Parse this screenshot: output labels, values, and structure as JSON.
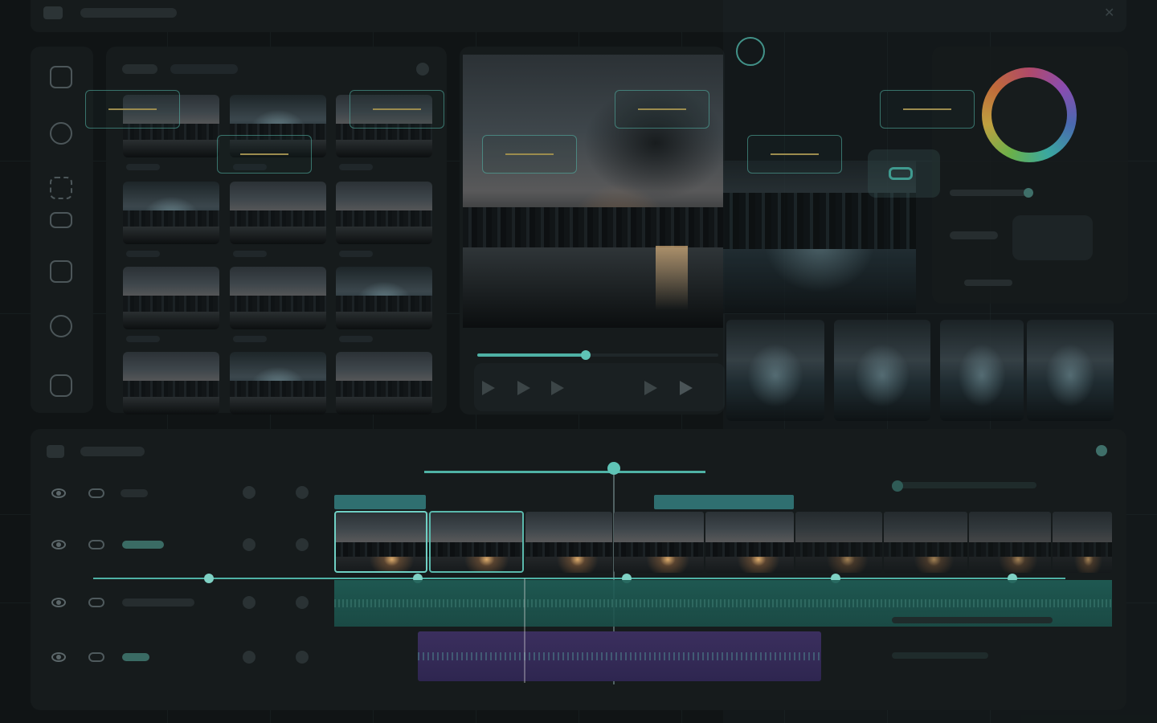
{
  "app": {
    "title": "",
    "accent_color": "#5fc4b6",
    "annotation_color": "#9c8c4e",
    "audio_color": "#4a3a6e"
  },
  "toolbar": {
    "left_icon": "folder-icon",
    "right_icon": "close-icon"
  },
  "sidebar": {
    "icons": [
      "media-icon",
      "effects-icon",
      "transitions-icon",
      "audio-icon",
      "titles-icon",
      "color-icon",
      "export-icon"
    ]
  },
  "media_library": {
    "thumbnail_count": 12
  },
  "preview": {
    "scrubber_progress": 0.45,
    "controls": [
      "previous-frame-icon",
      "play-icon",
      "next-frame-icon"
    ]
  },
  "inspector": {
    "color_wheel": "hue-wheel"
  },
  "timeline": {
    "tracks": [
      {
        "type": "video-overlay"
      },
      {
        "type": "video"
      },
      {
        "type": "audio"
      },
      {
        "type": "audio-music"
      }
    ],
    "keyframe_count": 5
  }
}
